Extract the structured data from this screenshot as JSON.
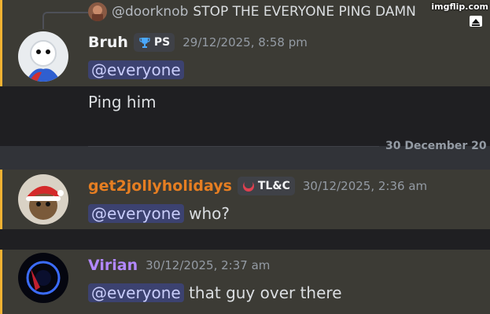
{
  "watermark": "imgflip.com",
  "colors": {
    "background": "#313338",
    "mention_highlight": "#3c3b35",
    "mention_stripe": "#f0b232",
    "mention_pill": "#3c4270",
    "bruh_name": "#f2f3f5",
    "jolly_name": "#e67e22",
    "virian_name": "#b388ff"
  },
  "messages": [
    {
      "reply": {
        "user": "@doorknob",
        "text": "STOP THE EVERYONE PING DAMN"
      },
      "username": "Bruh",
      "tag": {
        "icon": "trophy-icon",
        "label": "PS"
      },
      "timestamp": "29/12/2025, 8:58 pm",
      "lines": [
        {
          "mention": "@everyone",
          "text": ""
        },
        {
          "mention": "",
          "text": "Ping him"
        }
      ]
    },
    {
      "username": "get2jollyholidays",
      "tag": {
        "icon": "crescent-icon",
        "label": "TL&C"
      },
      "timestamp": "30/12/2025, 2:36 am",
      "lines": [
        {
          "mention": "@everyone",
          "text": " who?"
        }
      ]
    },
    {
      "username": "Virian",
      "timestamp": "30/12/2025, 2:37 am",
      "lines": [
        {
          "mention": "@everyone",
          "text": " that guy over there"
        }
      ]
    }
  ],
  "date_divider": "30 December 20"
}
